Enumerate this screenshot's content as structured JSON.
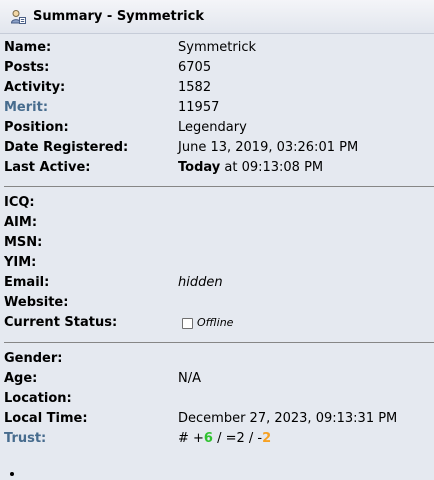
{
  "header": {
    "title": "Summary - Symmetrick",
    "icon": "user-profile-icon"
  },
  "basic": {
    "name_label": "Name:",
    "name": "Symmetrick",
    "posts_label": "Posts:",
    "posts": "6705",
    "activity_label": "Activity:",
    "activity": "1582",
    "merit_label": "Merit:",
    "merit": "11957",
    "position_label": "Position:",
    "position": "Legendary",
    "registered_label": "Date Registered:",
    "registered": "June 13, 2019, 03:26:01 PM",
    "lastactive_label": "Last Active:",
    "lastactive_day": "Today",
    "lastactive_time": " at 09:13:08 PM"
  },
  "contact": {
    "icq_label": "ICQ:",
    "aim_label": "AIM:",
    "msn_label": "MSN:",
    "yim_label": "YIM:",
    "email_label": "Email:",
    "email": "hidden",
    "website_label": "Website:",
    "status_label": "Current Status:",
    "status": "Offline"
  },
  "personal": {
    "gender_label": "Gender:",
    "age_label": "Age:",
    "age": "N/A",
    "location_label": "Location:",
    "localtime_label": "Local Time:",
    "localtime": "December 27, 2023, 09:13:31 PM",
    "trust_label": "Trust:",
    "trust_prefix": "# +",
    "trust_pos": "6",
    "trust_mid": " / =2 / -",
    "trust_neg": "2"
  },
  "colors": {
    "link": "#476c8e",
    "positive": "#30c230",
    "negative": "#f7a122"
  }
}
